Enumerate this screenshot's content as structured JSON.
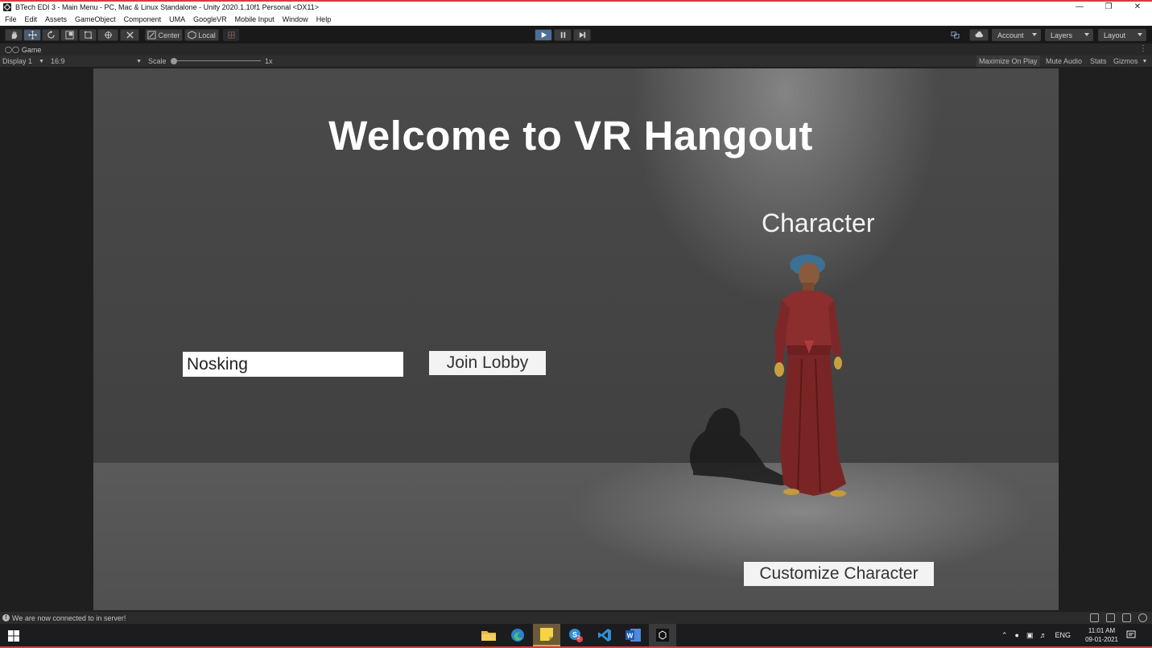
{
  "window": {
    "title": "BTech EDI 3 - Main Menu - PC, Mac & Linux Standalone - Unity 2020.1.10f1 Personal <DX11>",
    "controls": [
      "minimize-icon",
      "restore-icon",
      "close-icon"
    ]
  },
  "menu": [
    "File",
    "Edit",
    "Assets",
    "GameObject",
    "Component",
    "UMA",
    "GoogleVR",
    "Mobile Input",
    "Window",
    "Help"
  ],
  "toolbar": {
    "pivot_label": "Center",
    "space_label": "Local",
    "account_label": "Account",
    "layers_label": "Layers",
    "layout_label": "Layout"
  },
  "game_tab": {
    "label": "Game"
  },
  "game_bar": {
    "display": "Display 1",
    "aspect": "16:9",
    "scale_label": "Scale",
    "scale_value": "1x",
    "maximize": "Maximize On Play",
    "mute": "Mute Audio",
    "stats": "Stats",
    "gizmos": "Gizmos"
  },
  "scene": {
    "welcome": "Welcome to VR Hangout",
    "character_title": "Character",
    "name_value": "Nosking",
    "join_button": "Join Lobby",
    "customize_button": "Customize Character"
  },
  "status": {
    "message": "We are now connected to in server!"
  },
  "taskbar": {
    "apps": [
      "file-explorer-icon",
      "edge-icon",
      "sticky-notes-icon",
      "skype-icon",
      "vscode-icon",
      "word-icon",
      "unity-icon"
    ],
    "skype_badge": "2",
    "language": "ENG",
    "time": "11:01 AM",
    "date": "09-01-2021"
  },
  "colors": {
    "accent_border": "#d43c3c",
    "toolbar_bg": "#191919",
    "play_button": "#4a6f9a"
  }
}
